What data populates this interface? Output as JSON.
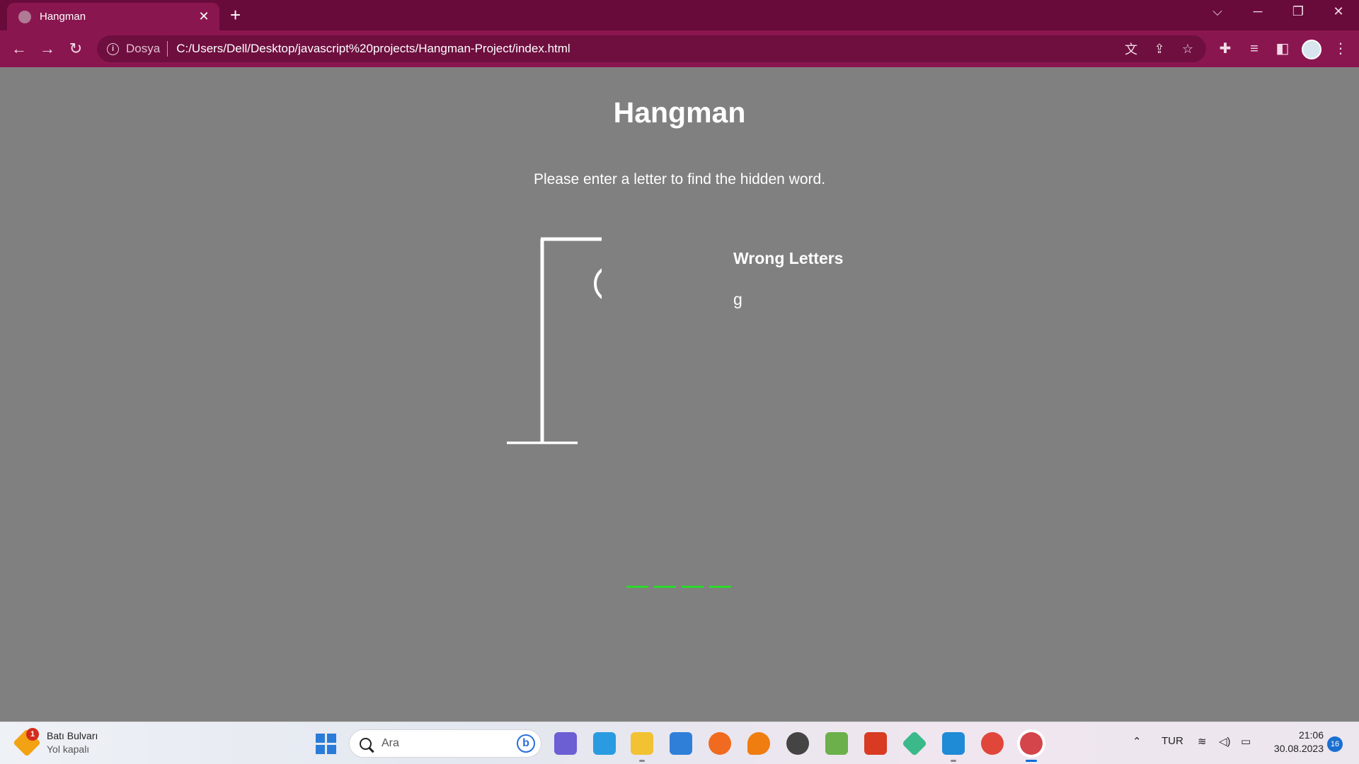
{
  "browser": {
    "tab_title": "Hangman",
    "tab_close": "✕",
    "new_tab": "+",
    "scheme_label": "Dosya",
    "url": "C:/Users/Dell/Desktop/javascript%20projects/Hangman-Project/index.html"
  },
  "page": {
    "title": "Hangman",
    "subtitle": "Please enter a letter to find the hidden word.",
    "wrong_letters_title": "Wrong Letters",
    "wrong_letters": "g",
    "word_slots": [
      "",
      "",
      "",
      ""
    ],
    "slot_color": "#2ad92a"
  },
  "taskbar": {
    "weather_badge": "1",
    "weather_title": "Batı Bulvarı",
    "weather_subtitle": "Yol kapalı",
    "search_placeholder": "Ara",
    "language": "TUR",
    "time": "21:06",
    "date": "30.08.2023",
    "notification_count": "16"
  },
  "colors": {
    "tab_bar": "#680b3b",
    "toolbar": "#8a1650",
    "page_background": "#808080"
  }
}
